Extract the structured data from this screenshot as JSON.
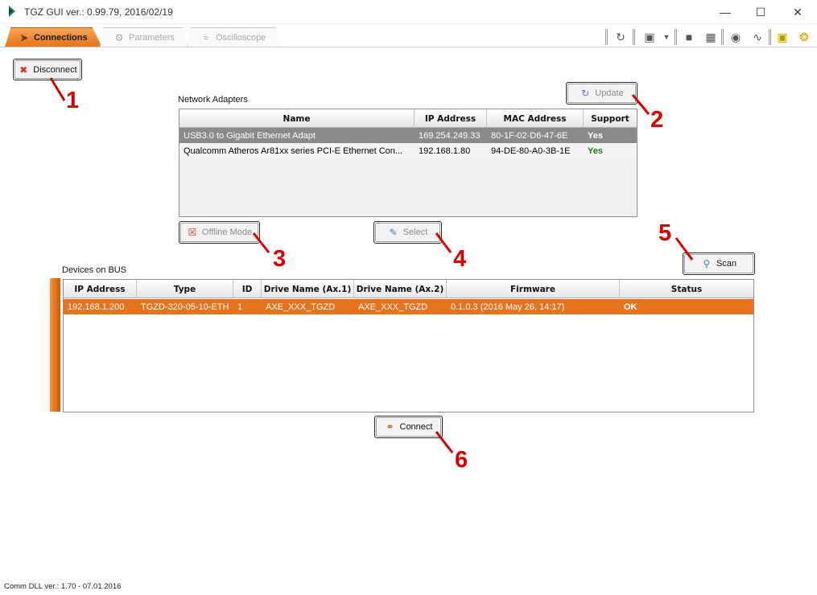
{
  "window": {
    "title": "TGZ GUI   ver.: 0.99.79,  2016/02/19",
    "minimize": "—",
    "maximize": "☐",
    "close": "✕"
  },
  "tabs": [
    {
      "label": "Connections",
      "icon": "plug-icon",
      "active": true
    },
    {
      "label": "Parameters",
      "icon": "gear-icon",
      "active": false
    },
    {
      "label": "Oscilloscope",
      "icon": "chart-icon",
      "active": false
    }
  ],
  "toolbar": {
    "icons": [
      "refresh-icon",
      "package-icon",
      "dropdown-arrow-icon",
      "folder-icon",
      "save-icon",
      "eye-icon",
      "graph-icon",
      "info-icon",
      "help-icon"
    ]
  },
  "buttons": {
    "disconnect": "Disconnect",
    "update": "Update",
    "offline_mode": "Offline Mode",
    "select": "Select",
    "scan": "Scan",
    "connect": "Connect"
  },
  "network_adapters": {
    "title": "Network Adapters",
    "columns": [
      "Name",
      "IP Address",
      "MAC Address",
      "Support"
    ],
    "rows": [
      {
        "name": "USB3.0 to Gigabit Ethernet Adapt",
        "ip": "169.254.249.33",
        "mac": "80-1F-02-D6-47-6E",
        "support": "Yes",
        "selected": true
      },
      {
        "name": "Qualcomm Atheros Ar81xx series PCI-E Ethernet Con...",
        "ip": "192.168.1.80",
        "mac": "94-DE-80-A0-3B-1E",
        "support": "Yes",
        "selected": false
      }
    ]
  },
  "devices": {
    "title": "Devices on BUS",
    "columns": [
      "IP Address",
      "Type",
      "ID",
      "Drive Name (Ax.1)",
      "Drive Name (Ax.2)",
      "Firmware",
      "Status"
    ],
    "rows": [
      {
        "ip": "192.168.1.200",
        "type": "TGZD-320-05-10-ETH",
        "id": "1",
        "drive1": "AXE_XXX_TGZD",
        "drive2": "AXE_XXX_TGZD",
        "firmware": "0.1.0.3 (2016 May 26, 14:17)",
        "status": "OK"
      }
    ]
  },
  "annotations": [
    "1",
    "2",
    "3",
    "4",
    "5",
    "6"
  ],
  "status_bar": "Comm DLL ver.: 1.70 - 07.01.2016",
  "colors": {
    "accent": "#e8731a",
    "selected_row_gray": "#8a8a8a",
    "support_yes_green": "#1a7a1a",
    "annotation_red": "#d90000"
  }
}
